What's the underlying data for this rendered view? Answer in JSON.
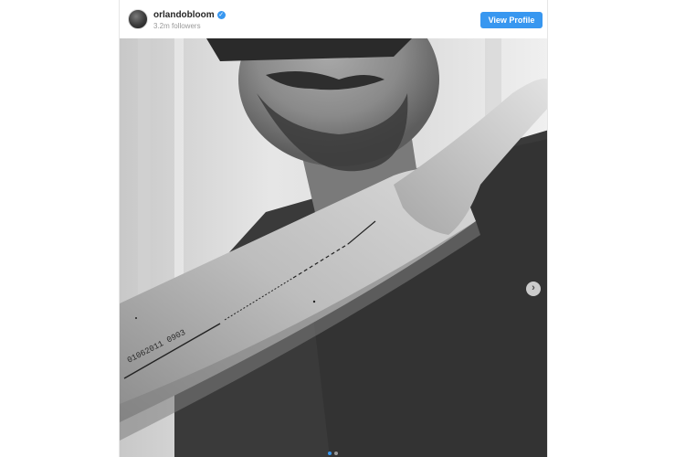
{
  "post": {
    "username": "orlandobloom",
    "followers": "3.2m followers",
    "view_profile_label": "View Profile",
    "verified_glyph": "✓",
    "tattoo_text": "01062011 0903",
    "next_glyph": "›",
    "carousel": {
      "total": 2,
      "current": 1
    }
  },
  "colors": {
    "accent": "#3897f0",
    "username": "#262626",
    "secondary_text": "#999999"
  }
}
